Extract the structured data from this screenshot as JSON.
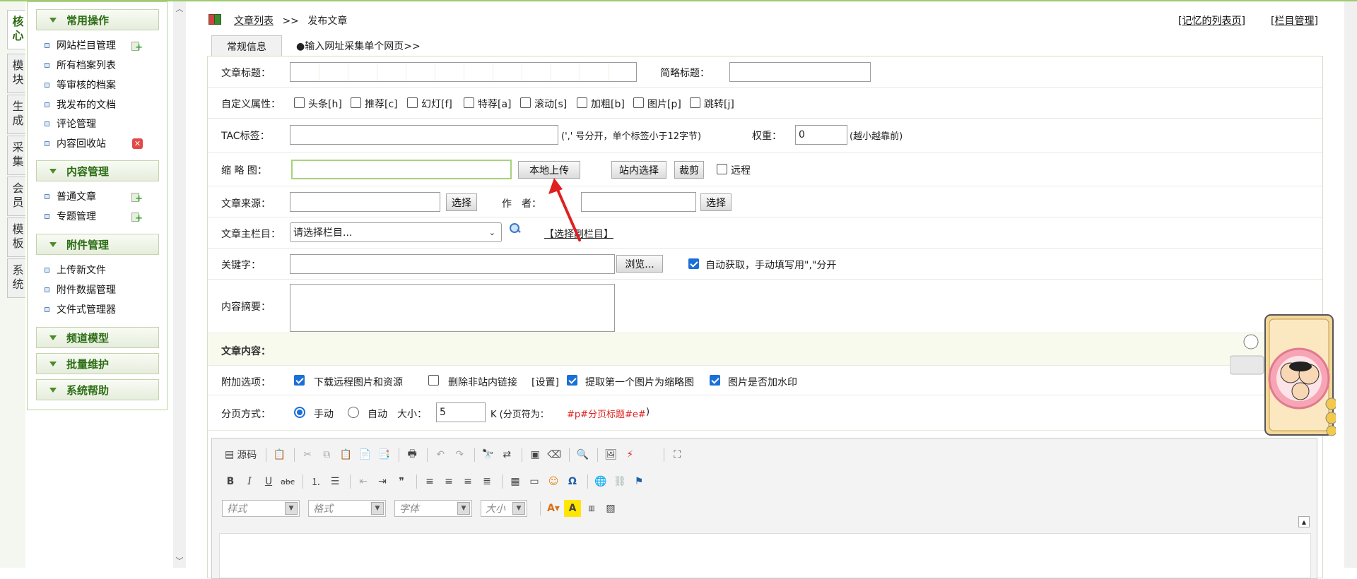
{
  "sidebar_tabs": [
    "核心",
    "模块",
    "生成",
    "采集",
    "会员",
    "模板",
    "系统"
  ],
  "menu": {
    "groups": [
      {
        "title": "常用操作",
        "items": [
          "网站栏目管理",
          "所有档案列表",
          "等审核的档案",
          "我发布的文档",
          "评论管理",
          "内容回收站"
        ]
      },
      {
        "title": "内容管理",
        "items": [
          "普通文章",
          "专题管理"
        ]
      },
      {
        "title": "附件管理",
        "items": [
          "上传新文件",
          "附件数据管理",
          "文件式管理器"
        ]
      },
      {
        "title": "频道模型",
        "items": []
      },
      {
        "title": "批量维护",
        "items": []
      },
      {
        "title": "系统帮助",
        "items": []
      }
    ]
  },
  "breadcrumb": {
    "link": "文章列表",
    "sep": ">>",
    "current": "发布文章"
  },
  "top_links": {
    "history": "[记忆的列表页]",
    "column": "[栏目管理]"
  },
  "tabs": {
    "normal": "常规信息",
    "collect": "●输入网址采集单个网页>>"
  },
  "form": {
    "title_label": "文章标题：",
    "short_title_label": "简略标题：",
    "attr_label": "自定义属性：",
    "attrs": [
      "头条[h]",
      "推荐[c]",
      "幻灯[f]",
      "特荐[a]",
      "滚动[s]",
      "加粗[b]",
      "图片[p]",
      "跳转[j]"
    ],
    "tag_label": "TAC标签：",
    "tag_hint": "(',' 号分开，单个标签小于12字节)",
    "weight_label": "权重：",
    "weight_value": "0",
    "weight_hint": "(越小越靠前)",
    "thumb_label": "缩 略 图：",
    "local_upload": "本地上传",
    "site_select": "站内选择",
    "crop": "裁剪",
    "remote": "远程",
    "source_label": "文章来源：",
    "select_btn": "选择",
    "author_label": "作　者：",
    "main_column_label": "文章主栏目：",
    "column_placeholder": "请选择栏目...",
    "sub_column": "【选择副栏目】",
    "keywords_label": "关键字：",
    "browse": "浏览...",
    "auto_keywords": "自动获取，手动填写用\",\"分开",
    "summary_label": "内容摘要：",
    "content_label": "文章内容：",
    "options_label": "附加选项：",
    "opt_download": "下载远程图片和资源",
    "opt_delete_links": "删除非站内链接",
    "opt_settings": "[设置]",
    "opt_first_img": "提取第一个图片为缩略图",
    "opt_watermark": "图片是否加水印",
    "paging_label": "分页方式：",
    "manual": "手动",
    "auto": "自动",
    "size_label": "大小：",
    "size_value": "5",
    "size_unit": "K (分页符为：",
    "paging_marker": "#p#分页标题#e#",
    "paging_close": ")"
  },
  "editor": {
    "source": "源码",
    "combos": [
      "样式",
      "格式",
      "字体",
      "大小"
    ]
  },
  "colors": {
    "accent_green": "#2b6d14",
    "border_green": "#b9d39a",
    "check_blue": "#1b6fd8",
    "marker_red": "#e02020"
  }
}
